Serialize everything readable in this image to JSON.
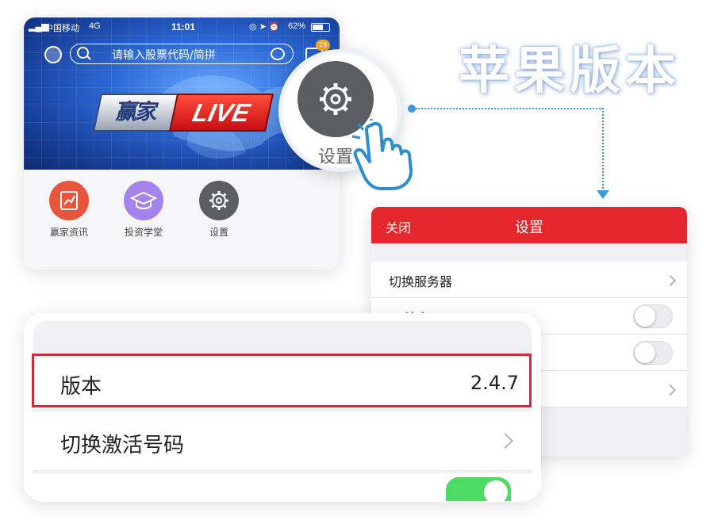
{
  "title": "苹果版本",
  "phone": {
    "status_bar": {
      "carrier": "中国移动",
      "network": "4G",
      "time": "11:01",
      "battery": "62%"
    },
    "search_placeholder": "请输入股票代码/简拼",
    "message_badge": "19",
    "banner_logo_cn": "赢家",
    "banner_logo_en": "LIVE",
    "quick_actions": [
      {
        "label": "赢家资讯",
        "icon": "chart-book-icon",
        "color": "#e8543c"
      },
      {
        "label": "投资学堂",
        "icon": "graduation-cap-icon",
        "color": "#a484ea"
      },
      {
        "label": "设置",
        "icon": "gear-icon",
        "color": "#5c5d62"
      }
    ]
  },
  "zoom_bubble": {
    "label": "设置",
    "icon": "gear-icon"
  },
  "settings_panel": {
    "close_label": "关闭",
    "title": "设置",
    "rows": [
      {
        "label": "切换服务器",
        "control": "chevron"
      },
      {
        "label": "L2站点",
        "control": "toggle-off"
      },
      {
        "label": "",
        "control": "toggle-off"
      },
      {
        "label": "",
        "control": "chevron"
      }
    ]
  },
  "zoom_detail": {
    "version_label": "版本",
    "version_value": "2.4.7",
    "activation_label": "切换激活号码"
  },
  "colors": {
    "accent_red": "#e5262c",
    "highlight_frame": "#d7263b",
    "connector_blue": "#3a9bdc",
    "toggle_on_green": "#4cd964"
  }
}
